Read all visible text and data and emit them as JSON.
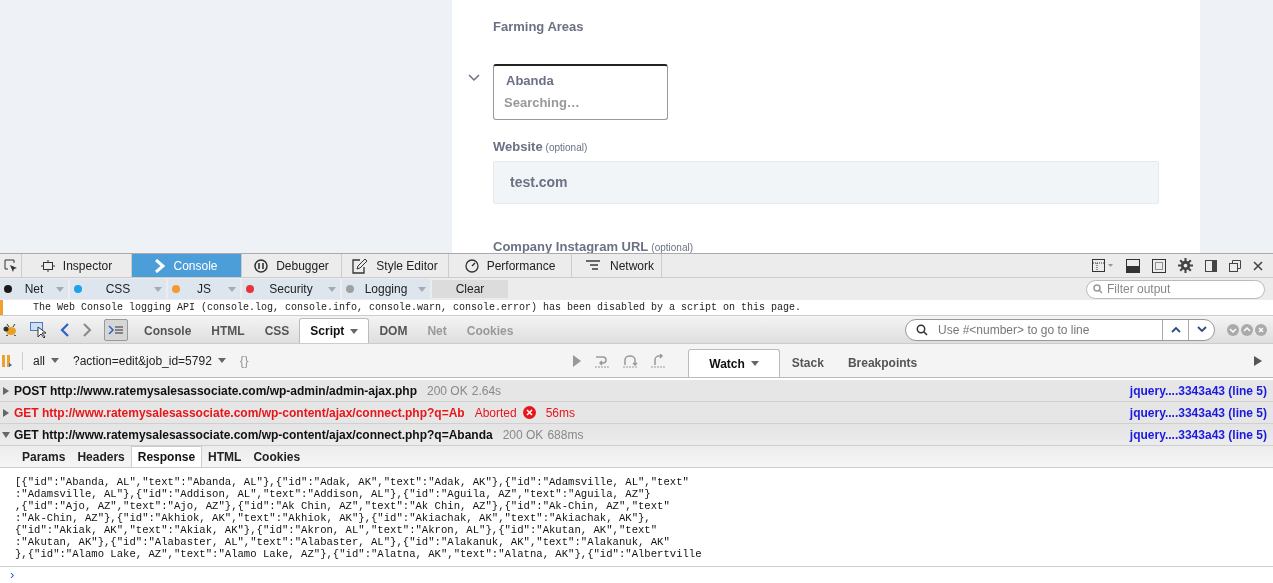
{
  "page": {
    "section_label": "Farming Areas",
    "tag_input": {
      "tag": "Abanda",
      "status": "Searching…"
    },
    "website": {
      "label": "Website",
      "hint": "(optional)",
      "value": "test.com"
    },
    "instagram": {
      "label": "Company Instagram URL",
      "hint": "(optional)"
    }
  },
  "devtools": {
    "tabs": [
      {
        "label": "Inspector",
        "selected": false
      },
      {
        "label": "Console",
        "selected": true
      },
      {
        "label": "Debugger",
        "selected": false
      },
      {
        "label": "Style Editor",
        "selected": false
      },
      {
        "label": "Performance",
        "selected": false
      },
      {
        "label": "Network",
        "selected": false
      }
    ],
    "filters": [
      {
        "label": "Net",
        "color": "#1a1a1a"
      },
      {
        "label": "CSS",
        "color": "#1aa3e8"
      },
      {
        "label": "JS",
        "color": "#f29a2e"
      },
      {
        "label": "Security",
        "color": "#e8333c"
      },
      {
        "label": "Logging",
        "color": "#a0a0a0"
      }
    ],
    "clear_button": "Clear",
    "filter_placeholder": "Filter output",
    "console_message": "The Web Console logging API (console.log, console.info, console.warn, console.error) has been disabled by a script on this page."
  },
  "firebug": {
    "tabs": [
      {
        "label": "Console",
        "selected": false,
        "disabled": false
      },
      {
        "label": "HTML",
        "selected": false,
        "disabled": false
      },
      {
        "label": "CSS",
        "selected": false,
        "disabled": false
      },
      {
        "label": "Script",
        "selected": true,
        "disabled": false
      },
      {
        "label": "DOM",
        "selected": false,
        "disabled": false
      },
      {
        "label": "Net",
        "selected": false,
        "disabled": true
      },
      {
        "label": "Cookies",
        "selected": false,
        "disabled": true
      }
    ],
    "search_placeholder": "Use #<number> to go to line",
    "scope": "all",
    "file": "?action=edit&job_id=5792",
    "pretty_print": "{}",
    "side_tabs": [
      {
        "label": "Watch",
        "selected": true
      },
      {
        "label": "Stack",
        "selected": false
      },
      {
        "label": "Breakpoints",
        "selected": false
      }
    ],
    "requests": [
      {
        "method": "POST",
        "url": "http://www.ratemysalesassociate.com/wp-admin/admin-ajax.php",
        "status": "200 OK",
        "time": "2.64s",
        "source": "jquery....3343a43 (line 5)",
        "failed": false,
        "expanded": false
      },
      {
        "method": "GET",
        "url": "http://www.ratemysalesassociate.com/wp-content/ajax/connect.php?q=Ab",
        "status": "Aborted",
        "time": "56ms",
        "source": "jquery....3343a43 (line 5)",
        "failed": true,
        "expanded": false
      },
      {
        "method": "GET",
        "url": "http://www.ratemysalesassociate.com/wp-content/ajax/connect.php?q=Abanda",
        "status": "200 OK",
        "time": "688ms",
        "source": "jquery....3343a43 (line 5)",
        "failed": false,
        "expanded": true
      }
    ],
    "response_tabs": [
      {
        "label": "Params",
        "selected": false
      },
      {
        "label": "Headers",
        "selected": false
      },
      {
        "label": "Response",
        "selected": true
      },
      {
        "label": "HTML",
        "selected": false
      },
      {
        "label": "Cookies",
        "selected": false
      }
    ],
    "response_lines": [
      "[{\"id\":\"Abanda, AL\",\"text\":\"Abanda, AL\"},{\"id\":\"Adak, AK\",\"text\":\"Adak, AK\"},{\"id\":\"Adamsville, AL\",\"text\"",
      ":\"Adamsville, AL\"},{\"id\":\"Addison, AL\",\"text\":\"Addison, AL\"},{\"id\":\"Aguila, AZ\",\"text\":\"Aguila, AZ\"}",
      ",{\"id\":\"Ajo, AZ\",\"text\":\"Ajo, AZ\"},{\"id\":\"Ak Chin, AZ\",\"text\":\"Ak Chin, AZ\"},{\"id\":\"Ak-Chin, AZ\",\"text\"",
      ":\"Ak-Chin, AZ\"},{\"id\":\"Akhiok, AK\",\"text\":\"Akhiok, AK\"},{\"id\":\"Akiachak, AK\",\"text\":\"Akiachak, AK\"},",
      "{\"id\":\"Akiak, AK\",\"text\":\"Akiak, AK\"},{\"id\":\"Akron, AL\",\"text\":\"Akron, AL\"},{\"id\":\"Akutan, AK\",\"text\"",
      ":\"Akutan, AK\"},{\"id\":\"Alabaster, AL\",\"text\":\"Alabaster, AL\"},{\"id\":\"Alakanuk, AK\",\"text\":\"Alakanuk, AK\"",
      "},{\"id\":\"Alamo Lake, AZ\",\"text\":\"Alamo Lake, AZ\"},{\"id\":\"Alatna, AK\",\"text\":\"Alatna, AK\"},{\"id\":\"Albertville"
    ],
    "command_prompt": "›"
  }
}
